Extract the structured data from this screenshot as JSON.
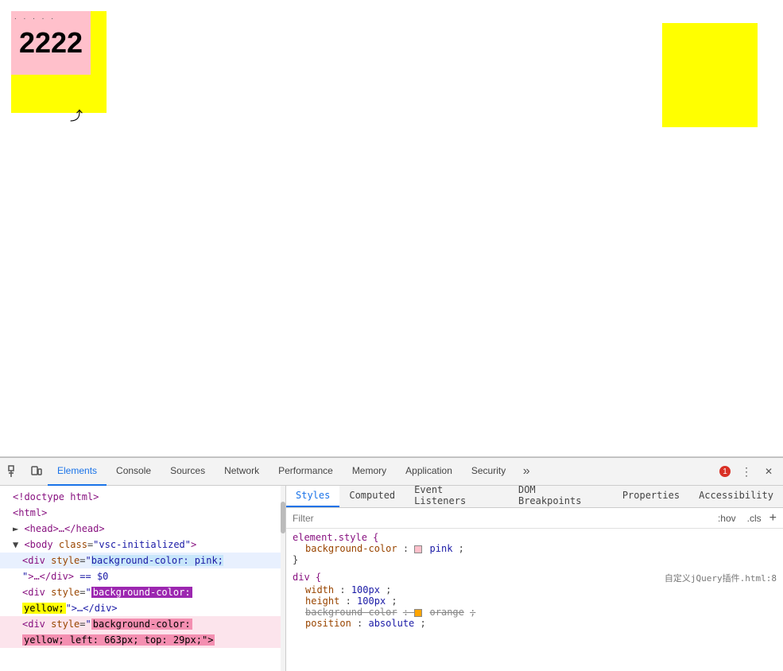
{
  "viewport": {
    "yellow_box_left": {
      "number": "2222",
      "dots": ". . . . ."
    },
    "cursor_symbol": "↖"
  },
  "devtools": {
    "toolbar": {
      "tabs": [
        {
          "label": "Elements",
          "active": true
        },
        {
          "label": "Console",
          "active": false
        },
        {
          "label": "Sources",
          "active": false
        },
        {
          "label": "Network",
          "active": false
        },
        {
          "label": "Performance",
          "active": false
        },
        {
          "label": "Memory",
          "active": false
        },
        {
          "label": "Application",
          "active": false
        },
        {
          "label": "Security",
          "active": false
        }
      ],
      "more_label": "»",
      "error_count": "1",
      "more_options": "⋮"
    },
    "dom_panel": {
      "lines": [
        {
          "text": "<!doctype html>",
          "type": "normal",
          "indent": 0
        },
        {
          "text": "<html>",
          "type": "normal",
          "indent": 0
        },
        {
          "text": "▶ <head>…</head>",
          "type": "normal",
          "indent": 0
        },
        {
          "text": "▼ <body class=\"vsc-initialized\">",
          "type": "normal",
          "indent": 0
        },
        {
          "text": "  <div style=\"background-color: pink;",
          "type": "highlighted",
          "indent": 1,
          "highlight": "normal"
        },
        {
          "text": "  \">…</div> == $0",
          "type": "normal",
          "indent": 1
        },
        {
          "text": "  <div style=\"background-color:",
          "type": "selected",
          "indent": 1
        },
        {
          "text": "  yellow;\">…</div>",
          "type": "selected_yellow",
          "indent": 1
        },
        {
          "text": "  <div style=\"background-color:",
          "type": "normal_highlight",
          "indent": 1
        },
        {
          "text": "  yellow; left: 663px; top: 29px;\">",
          "type": "normal_highlight_end",
          "indent": 1
        }
      ]
    },
    "styles_panel": {
      "sub_tabs": [
        {
          "label": "Styles",
          "active": true
        },
        {
          "label": "Computed",
          "active": false
        },
        {
          "label": "Event Listeners",
          "active": false
        },
        {
          "label": "DOM Breakpoints",
          "active": false
        },
        {
          "label": "Properties",
          "active": false
        },
        {
          "label": "Accessibility",
          "active": false
        }
      ],
      "filter_placeholder": "Filter",
      "filter_hov": ":hov",
      "filter_cls": ".cls",
      "filter_add": "+",
      "rules": [
        {
          "selector": "element.style {",
          "properties": [
            {
              "name": "background-color",
              "value": "pink",
              "color": "#ffc0cb",
              "strikethrough": false
            }
          ],
          "close": "}",
          "source": ""
        },
        {
          "selector": "div {",
          "properties": [
            {
              "name": "width",
              "value": "100px",
              "strikethrough": false
            },
            {
              "name": "height",
              "value": "100px",
              "strikethrough": false
            },
            {
              "name": "background-color",
              "value": "orange",
              "color": "#ffa500",
              "strikethrough": true
            }
          ],
          "close": "}",
          "source": "自定义jQuery插件.html:8"
        }
      ]
    }
  }
}
